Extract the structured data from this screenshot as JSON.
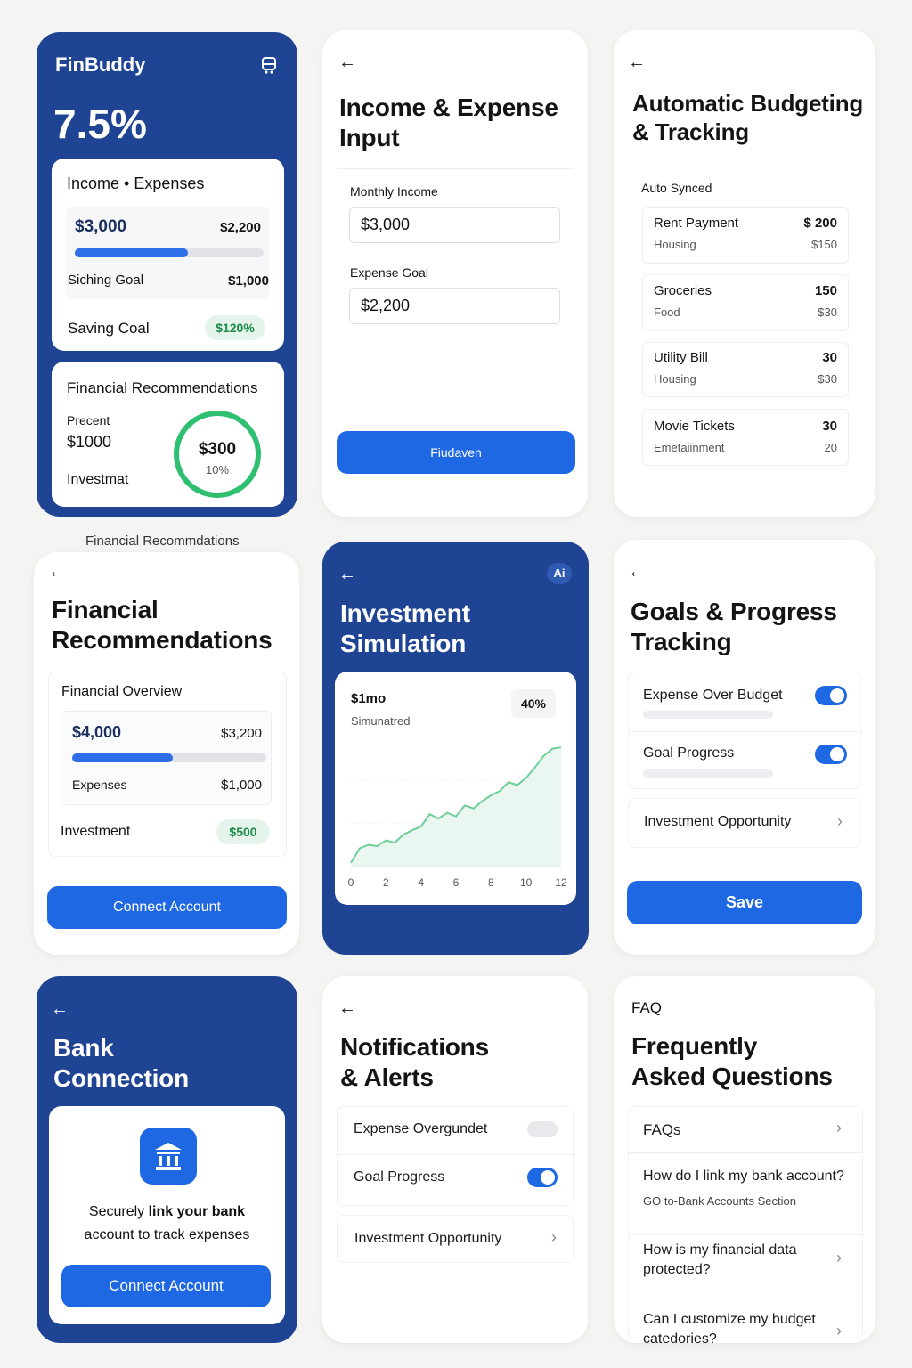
{
  "dashboard": {
    "app_name": "FinBuddy",
    "icon": "bus-icon",
    "headline_value": "7.5%",
    "income_expenses": {
      "title": "Income • Expenses",
      "income": "$3,000",
      "expense": "$2,200",
      "progress": 0.6,
      "goal_label": "Siching Goal",
      "goal_value": "$1,000",
      "saving_label": "Saving Coal",
      "saving_pill": "$120%"
    },
    "recommendations": {
      "title": "Financial Recommendations",
      "precent_label": "Precent",
      "precent_value": "$1000",
      "invest_label": "Investmat",
      "ring_value": "$300",
      "ring_pct": "10%"
    }
  },
  "income_input": {
    "title_line1": "Income & Expense",
    "title_line2": "Input",
    "monthly_income_label": "Monthly Income",
    "monthly_income_value": "$3,000",
    "expense_goal_label": "Expense Goal",
    "expense_goal_value": "$2,200",
    "button": "Fiudaven"
  },
  "auto_budget": {
    "title_line1": "Automatic Budgeting",
    "title_line2": "& Tracking",
    "section": "Auto Synced",
    "items": [
      {
        "name": "Rent Payment",
        "amount": "$ 200",
        "category": "Housing",
        "sub_amount": "$150"
      },
      {
        "name": "Groceries",
        "amount": "150",
        "category": "Food",
        "sub_amount": "$30"
      },
      {
        "name": "Utility Bill",
        "amount": "30",
        "category": "Housing",
        "sub_amount": "$30"
      },
      {
        "name": "Movie Tickets",
        "amount": "30",
        "category": "Emetaiinment",
        "sub_amount": "20"
      }
    ]
  },
  "recs_screen": {
    "caption": "Financial Recommdations",
    "title_line1": "Financial",
    "title_line2": "Recommendations",
    "overview_title": "Financial Overview",
    "total": "$4,000",
    "spent": "$3,200",
    "progress": 0.52,
    "expenses_label": "Expenses",
    "expenses_value": "$1,000",
    "investment_label": "Investment",
    "investment_pill": "$500",
    "button": "Connect Account"
  },
  "investment": {
    "title_line1": "Investment",
    "title_line2": "Simulation",
    "badge": "Ai",
    "value": "$1mo",
    "subtitle": "Simunatred",
    "pct": "40%",
    "x_ticks": [
      "0",
      "2",
      "4",
      "6",
      "8",
      "10",
      "12"
    ]
  },
  "chart_data": {
    "type": "area",
    "x": [
      0,
      0.5,
      1,
      1.5,
      2,
      2.5,
      3,
      3.5,
      4,
      4.5,
      5,
      5.5,
      6,
      6.5,
      7,
      7.5,
      8,
      8.5,
      9,
      9.5,
      10,
      10.5,
      11,
      11.5,
      12
    ],
    "y": [
      0.5,
      2.5,
      3.0,
      2.8,
      3.6,
      3.3,
      4.4,
      5.0,
      5.5,
      7.2,
      6.6,
      7.4,
      6.9,
      8.4,
      8.0,
      9.0,
      9.8,
      10.4,
      11.6,
      11.2,
      12.2,
      13.6,
      15.2,
      16.2,
      16.4
    ],
    "title": "",
    "xlabel": "",
    "ylabel": "",
    "xlim": [
      0,
      12
    ],
    "ylim": [
      0,
      18
    ],
    "grid": true,
    "line_color": "#6fcf97"
  },
  "goals": {
    "title_line1": "Goals & Progress",
    "title_line2": "Tracking",
    "items": [
      {
        "label": "Expense Over Budget",
        "on": true
      },
      {
        "label": "Goal Progress",
        "on": true
      }
    ],
    "link": "Investment Opportunity",
    "button": "Save"
  },
  "bank": {
    "title_line1": "Bank",
    "title_line2": "Connection",
    "icon": "bank-icon",
    "text_line1_a": "Securely ",
    "text_line1_b": "link your bank",
    "text_line2": "account to track expenses",
    "button": "Connect Account"
  },
  "notifications": {
    "title_line1": "Notifications",
    "title_line2": "& Alerts",
    "items": [
      {
        "label": "Expense Overgundet",
        "on": false
      },
      {
        "label": "Goal Progress",
        "on": true
      }
    ],
    "link": "Investment Opportunity"
  },
  "faq": {
    "tag": "FAQ",
    "title_line1": "Frequently",
    "title_line2": "Asked Questions",
    "items": [
      {
        "q": "FAQs",
        "a": ""
      },
      {
        "q": "How do I link my bank account?",
        "a": "GO to-Bank Accounts Section"
      },
      {
        "q": "How is my financial data protected?",
        "a": ""
      },
      {
        "q": "Can I customize my budget catedories?",
        "a": ""
      }
    ]
  },
  "colors": {
    "primary_blue": "#1f4494",
    "button_blue": "#1f68e4",
    "accent_green": "#2fbf71"
  }
}
